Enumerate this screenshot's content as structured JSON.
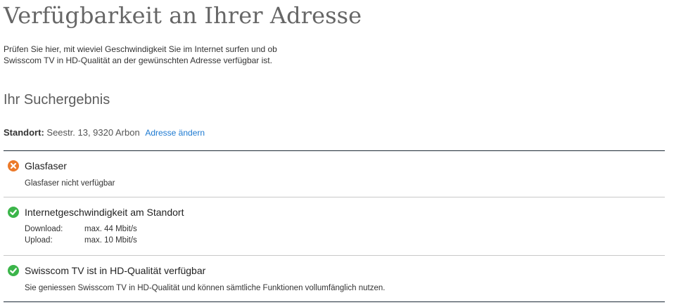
{
  "header": {
    "title": "Verfügbarkeit an Ihrer Adresse",
    "intro_line1": "Prüfen Sie hier, mit wieviel Geschwindigkeit Sie im Internet surfen und ob",
    "intro_line2": "Swisscom TV in HD-Qualität an der gewünschten Adresse verfügbar ist."
  },
  "result": {
    "heading": "Ihr Suchergebnis",
    "location_label": "Standort:",
    "location_value": "Seestr. 13, 9320 Arbon",
    "change_link": "Adresse ändern"
  },
  "sections": [
    {
      "status": "unavailable",
      "icon": "x-circle-icon",
      "title": "Glasfaser",
      "text": "Glasfaser nicht verfügbar"
    },
    {
      "status": "available",
      "icon": "check-circle-icon",
      "title": "Internetgeschwindigkeit am Standort",
      "download_label": "Download:",
      "download_value": "max. 44 Mbit/s",
      "upload_label": "Upload:",
      "upload_value": "max. 10 Mbit/s"
    },
    {
      "status": "available",
      "icon": "check-circle-icon",
      "title": "Swisscom TV ist in HD-Qualität verfügbar",
      "text": "Sie geniessen Swisscom TV in HD-Qualität und können sämtliche Funktionen vollumfänglich nutzen."
    }
  ],
  "colors": {
    "error": "#ec7a2a",
    "success": "#3bb54a",
    "link": "#1c79d1",
    "divider_dark": "#1d2a36",
    "divider_light": "#c8c8c8"
  }
}
